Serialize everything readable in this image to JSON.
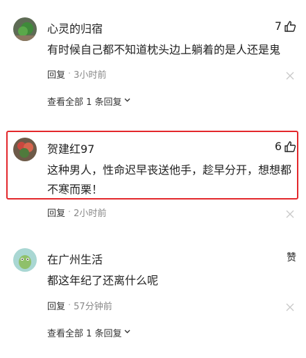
{
  "comments": [
    {
      "username": "心灵的归宿",
      "likes": "7",
      "text": "有时候自己都不知道枕头边上躺着的是人还是鬼",
      "reply_label": "回复",
      "time": "3小时前",
      "view_replies": "查看全部 1 条回复"
    },
    {
      "username": "贺建红97",
      "likes": "6",
      "text": "这种男人，性命迟早丧送他手，趁早分开，想想都不寒而栗！",
      "reply_label": "回复",
      "time": "2小时前"
    },
    {
      "username": "在广州生活",
      "likes": "赞",
      "text": "都这年纪了还离什么呢",
      "reply_label": "回复",
      "time": "57分钟前",
      "view_replies": "查看全部 1 条回复"
    }
  ],
  "separator": "·",
  "icons": {
    "like": "thumbs-up-icon",
    "close": "close-icon",
    "chevron": "chevron-down-icon"
  },
  "colors": {
    "highlight_border": "#e3262a",
    "meta_text": "#888888"
  }
}
